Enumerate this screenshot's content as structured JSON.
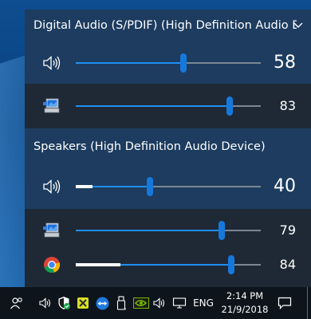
{
  "devices": [
    {
      "header": "Digital Audio (S/PDIF) (High Definition Audio Device)",
      "master": {
        "icon": "speaker-icon",
        "volume": 58,
        "volume_label": "58",
        "peak": 0
      },
      "apps": [
        {
          "icon": "system-sounds-icon",
          "volume": 83,
          "volume_label": "83",
          "peak": 0
        }
      ]
    },
    {
      "header": "Speakers (High Definition Audio Device)",
      "master": {
        "icon": "speaker-icon",
        "volume": 40,
        "volume_label": "40",
        "peak": 9
      },
      "apps": [
        {
          "icon": "system-sounds-icon",
          "volume": 79,
          "volume_label": "79",
          "peak": 0
        },
        {
          "icon": "chrome-icon",
          "volume": 84,
          "volume_label": "84",
          "peak": 24
        }
      ]
    }
  ],
  "taskbar": {
    "language": "ENG",
    "time": "2:14 PM",
    "date": "21/9/2018"
  },
  "colors": {
    "slider_fill": "#1e8ef2",
    "slider_thumb": "#1778dc",
    "device_bg": "#1d3c5f",
    "app_bg": "#1f2935"
  }
}
